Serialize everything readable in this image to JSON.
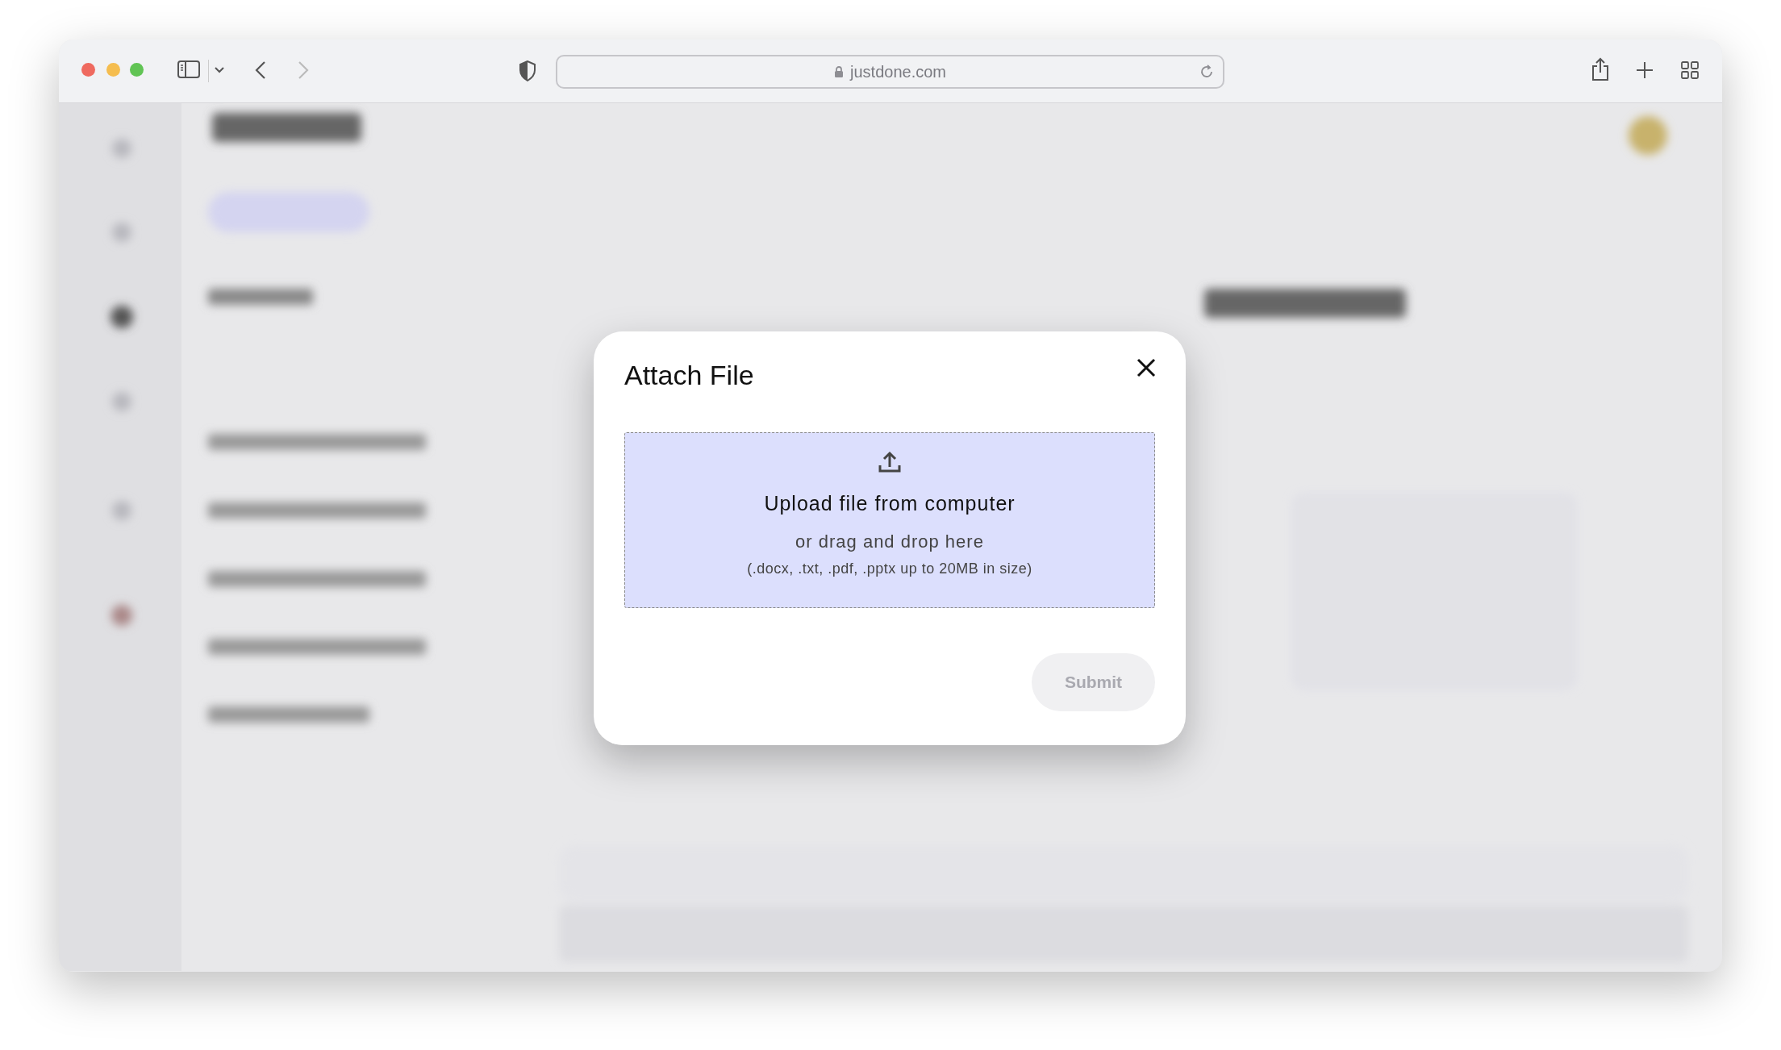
{
  "browser": {
    "url": "justdone.com",
    "back_enabled": true,
    "forward_enabled": false
  },
  "dialog": {
    "title": "Attach File",
    "dropzone": {
      "title": "Upload file from computer",
      "subtitle": "or drag and drop here",
      "hint": "(.docx, .txt, .pdf, .pptx up to 20MB in size)"
    },
    "submit": {
      "label": "Submit",
      "disabled": true
    }
  }
}
